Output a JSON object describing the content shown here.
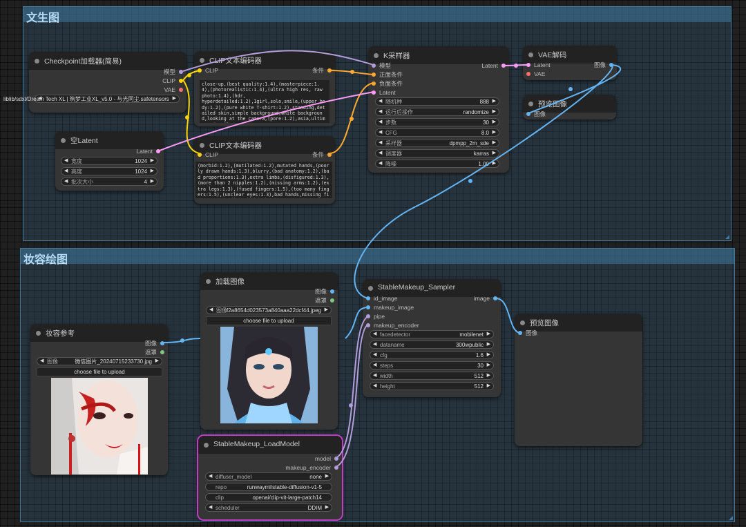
{
  "colors": {
    "clip": "#ffd500",
    "model": "#b39ddb",
    "vae": "#ff6e6e",
    "cond": "#ffa931",
    "latent": "#ff9cf9",
    "image": "#64b5f6",
    "mask": "#81c784",
    "pipe": "#b39ddb"
  },
  "groups": {
    "txt2img": "文生图",
    "makeup": "妆容绘图"
  },
  "checkpoint": {
    "title": "Checkpoint加载器(简易)",
    "out_model": "模型",
    "out_clip": "CLIP",
    "out_vae": "VAE",
    "ckpt_value": "liblib/sdxl/Dream Tech XL | 筑梦工业XL_v5.0 - 与光同尘.safetensors"
  },
  "clip_pos": {
    "title": "CLIP文本编码器",
    "in_clip": "CLIP",
    "out_cond": "条件",
    "text": "close-up,(best quality:1.4),(masterpiece:1.4),(photorealistic:1.4),(ultra high res, raw photo:1.4),(hdr,\nhyperdetailed:1.2),1girl,solo,smile,(upper body:1.2),(pure white T-shirt:1.2),standing,detailed skin,simple background,white background,looking at the camera,(pore:1.2),asia,ultimate details,"
  },
  "clip_neg": {
    "title": "CLIP文本编码器",
    "in_clip": "CLIP",
    "out_cond": "条件",
    "text": "(morbid:1.2),(mutilated:1.2),mutated hands,(poorly drawn hands:1.3),blurry,(bad anatomy:1.2),(bad proportions:1.3),extra limbs,(disfigured:1.3),(more than 2 nipples:1.2),(missing arms:1.2),(extra legs:1.3),(fused fingers:1.5),(too many fingers:1.5),(unclear eyes:1.3),bad hands,missing fingers,extra digit,bad body,"
  },
  "latent": {
    "title": "空Latent",
    "out_latent": "Latent",
    "w_label": "宽度",
    "w_value": "1024",
    "h_label": "高度",
    "h_value": "1024",
    "b_label": "批次大小",
    "b_value": "4"
  },
  "ksampler": {
    "title": "K采样器",
    "in_model": "模型",
    "in_pos": "正面条件",
    "in_neg": "负面条件",
    "in_latent": "Latent",
    "out_latent": "Latent",
    "seed_label": "随机种",
    "seed_value": "888",
    "ctrl_label": "运行后操作",
    "ctrl_value": "randomize",
    "steps_label": "步数",
    "steps_value": "30",
    "cfg_label": "CFG",
    "cfg_value": "8.0",
    "sampler_label": "采样器",
    "sampler_value": "dpmpp_2m_sde",
    "sched_label": "调度器",
    "sched_value": "karras",
    "denoise_label": "降噪",
    "denoise_value": "1.00"
  },
  "vae_decode": {
    "title": "VAE解码",
    "in_latent": "Latent",
    "in_vae": "VAE",
    "out_image": "图像"
  },
  "preview1": {
    "title": "预览图像",
    "in_image": "图像"
  },
  "load_image": {
    "title": "加载图像",
    "out_image": "图像",
    "out_mask": "遮罩",
    "image_label": "图像",
    "image_value": "f2a8654d023573a840aaa22dcf44.jpeg",
    "upload": "choose file to upload"
  },
  "makeup_ref": {
    "title": "妆容参考",
    "out_image": "图像",
    "out_mask": "遮罩",
    "image_label": "图像",
    "image_value": "微信图片_20240715233730.jpg",
    "upload": "choose file to upload"
  },
  "sampler2": {
    "title": "StableMakeup_Sampler",
    "in_id": "id_image",
    "in_makeup": "makeup_image",
    "in_pipe": "pipe",
    "in_encoder": "makeup_encoder",
    "out_image": "image",
    "fd_label": "facedetector",
    "fd_value": "mobilenet",
    "dn_label": "dataname",
    "dn_value": "300wpublic",
    "cfg_label": "cfg",
    "cfg_value": "1.6",
    "steps_label": "steps",
    "steps_value": "30",
    "w_label": "width",
    "w_value": "512",
    "h_label": "height",
    "h_value": "512"
  },
  "preview2": {
    "title": "预览图像",
    "in_image": "图像"
  },
  "loadmodel": {
    "title": "StableMakeup_LoadModel",
    "out_model": "model",
    "out_encoder": "makeup_encoder",
    "dm_label": "diffuser_model",
    "dm_value": "none",
    "repo_label": "repo",
    "repo_value": "runwayml/stable-diffusion-v1-5",
    "clip_label": "clip",
    "clip_value": "openai/clip-vit-large-patch14",
    "sched_label": "scheduler",
    "sched_value": "DDIM"
  }
}
